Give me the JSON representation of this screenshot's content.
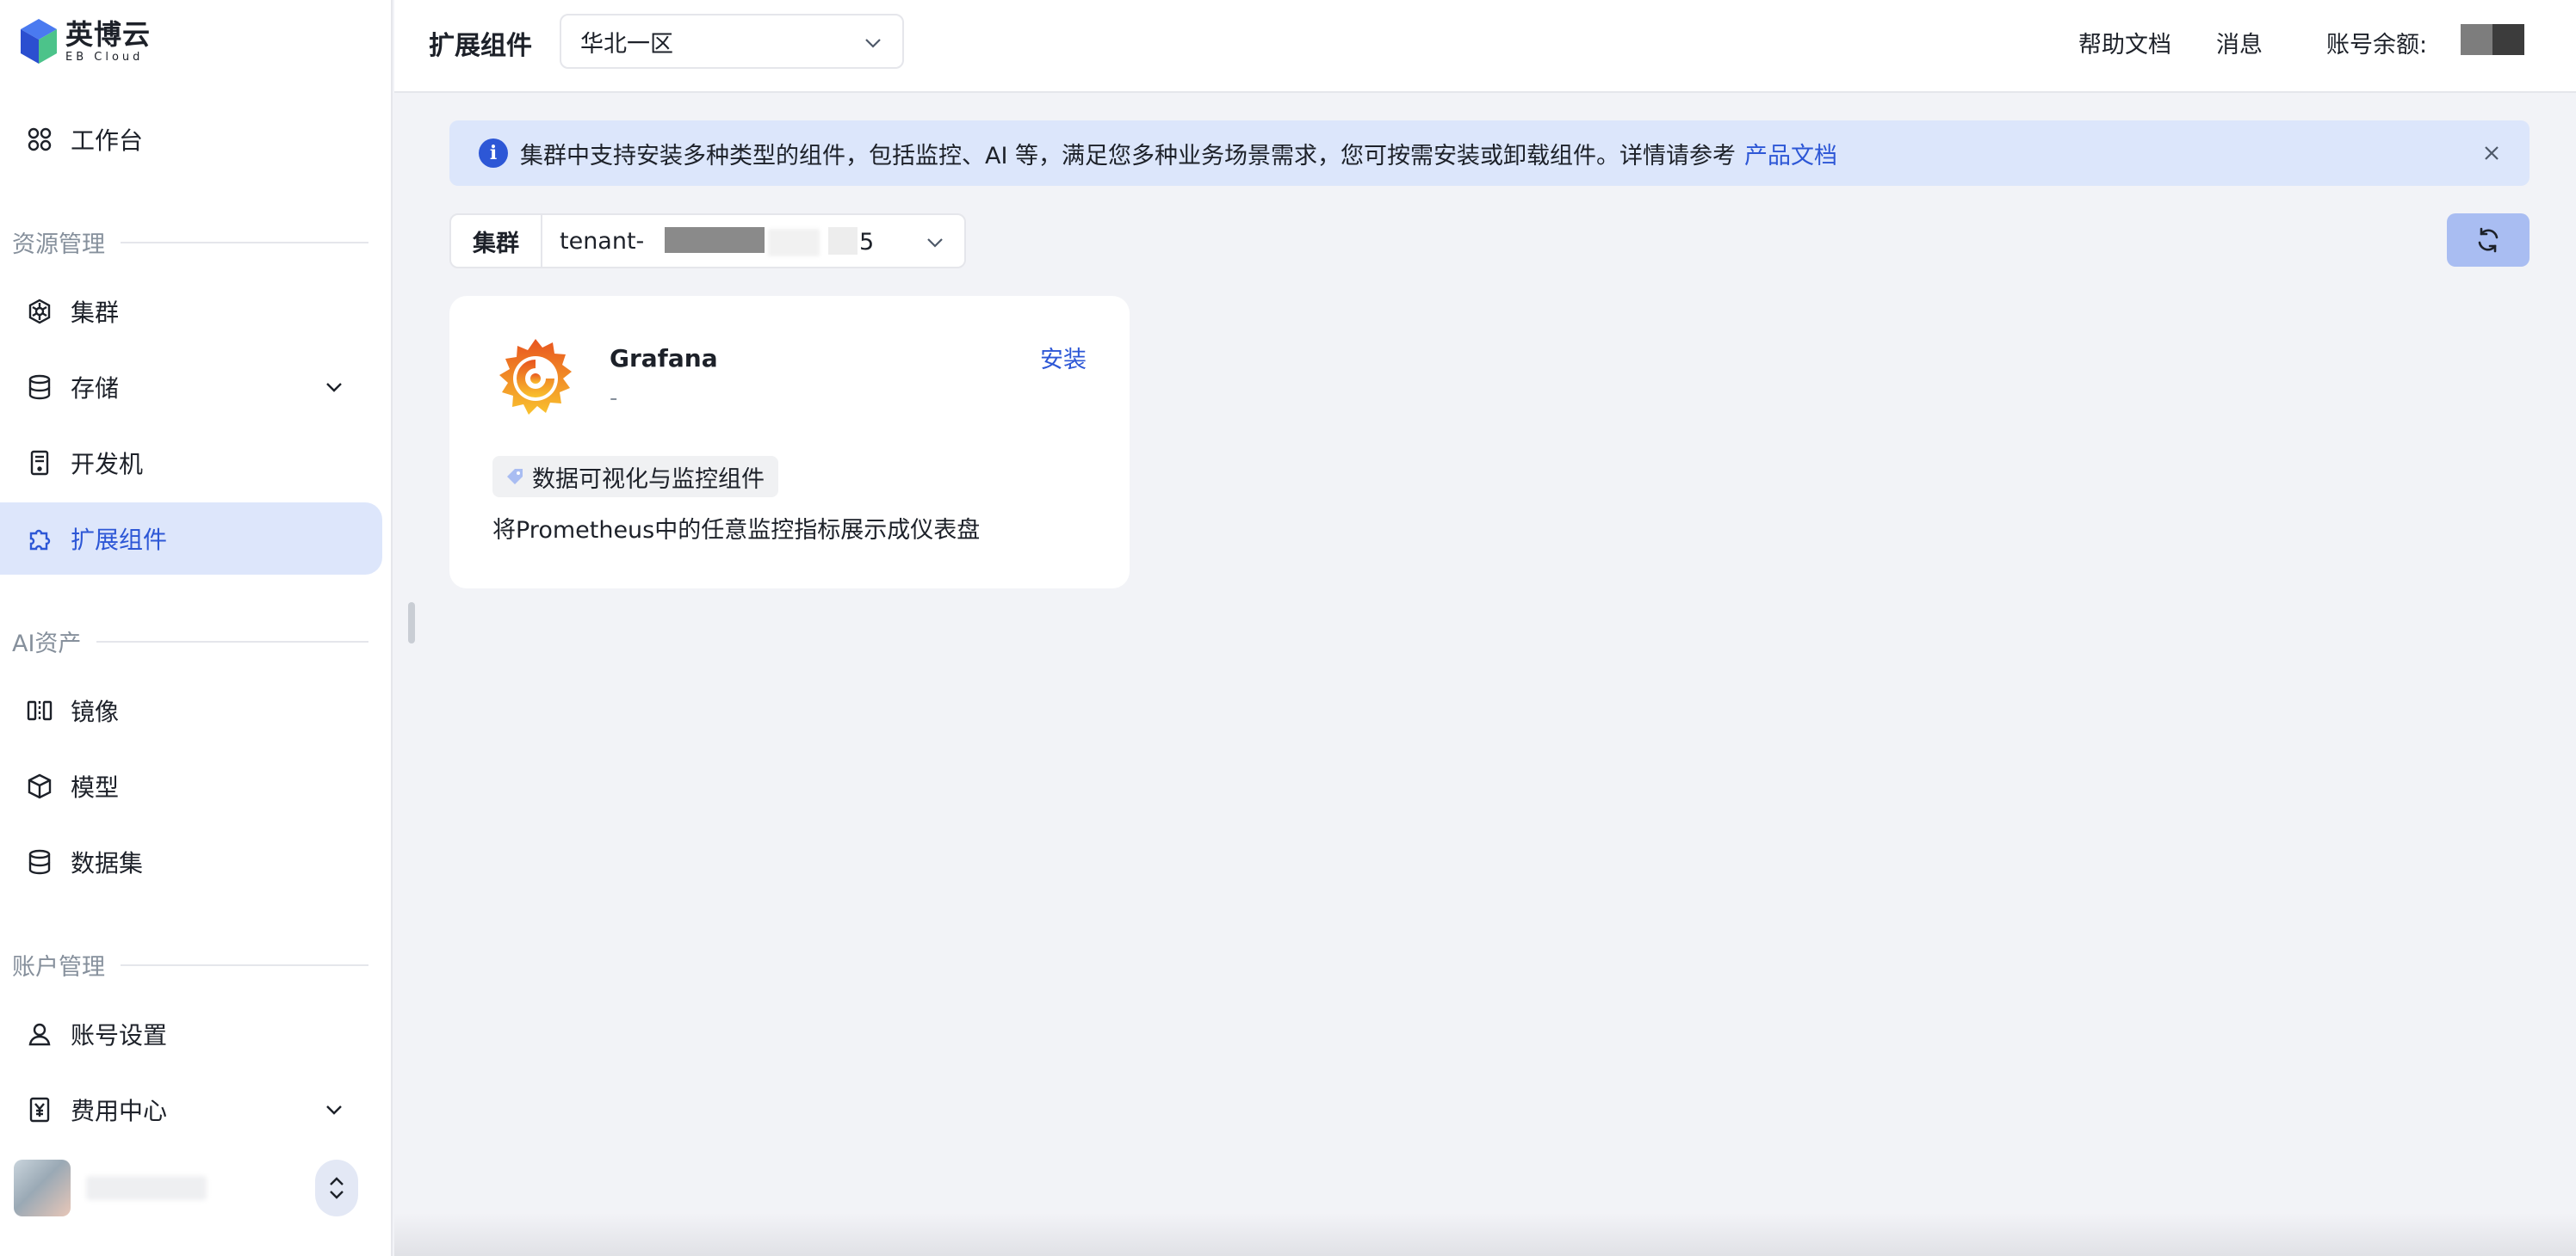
{
  "app": {
    "logo_cn": "英博云",
    "logo_en": "EB Cloud"
  },
  "sidebar": {
    "workbench": "工作台",
    "sections": {
      "resource": "资源管理",
      "ai_assets": "AI资产",
      "account": "账户管理"
    },
    "items": {
      "cluster": "集群",
      "storage": "存储",
      "devbox": "开发机",
      "extensions": "扩展组件",
      "image": "镜像",
      "model": "模型",
      "dataset": "数据集",
      "account_settings": "账号设置",
      "billing": "费用中心"
    },
    "active_item": "extensions"
  },
  "header": {
    "title": "扩展组件",
    "region": "华北一区",
    "help_docs": "帮助文档",
    "messages": "消息",
    "balance_label": "账号余额:"
  },
  "notice": {
    "text": "集群中支持安装多种类型的组件，包括监控、AI 等，满足您多种业务场景需求，您可按需安装或卸载组件。详情请参考",
    "link": "产品文档"
  },
  "cluster_filter": {
    "label": "集群",
    "value_prefix": "tenant-",
    "value_suffix": "5"
  },
  "components": [
    {
      "name": "Grafana",
      "version": "-",
      "action": "安装",
      "tag": "数据可视化与监控组件",
      "description": "将Prometheus中的任意监控指标展示成仪表盘"
    }
  ],
  "colors": {
    "accent": "#2d57d6",
    "active_bg": "#dde6fb",
    "page_bg": "#f2f3f7",
    "notice_bg": "#dce6fb"
  }
}
